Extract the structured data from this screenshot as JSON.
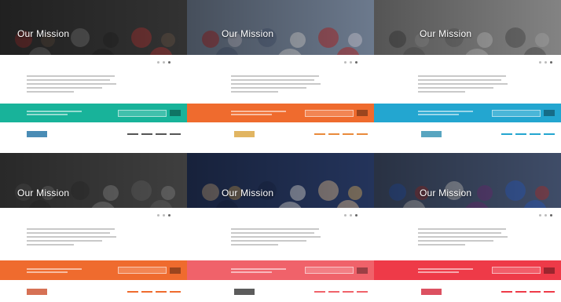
{
  "panels": [
    {
      "title": "Our Mission",
      "bar_color": "#18b39a",
      "nav_color": "#555555",
      "logo": "",
      "logo_color": "#1d6fa3",
      "hero_base": "#3b3b3b",
      "crowd": [
        "#b23b3b",
        "#6b5a4a",
        "#888888",
        "#2b2b2b"
      ]
    },
    {
      "title": "Our Mission",
      "bar_color": "#ef6b2e",
      "nav_color": "#e98a3b",
      "logo": "",
      "logo_color": "#d9a23b",
      "hero_base": "#7f8fa6",
      "crowd": [
        "#c93232",
        "#d8d8e6",
        "#5a6b8a",
        "#f0f0f0"
      ]
    },
    {
      "title": "Our Mission",
      "bar_color": "#23a6d0",
      "nav_color": "#23a6d0",
      "logo": "",
      "logo_color": "#2e8fb0",
      "hero_base": "#9a9a9a",
      "crowd": [
        "#5c5c5c",
        "#bcbcbc",
        "#777777",
        "#dcdcdc"
      ]
    },
    {
      "title": "Our Mission",
      "bar_color": "#ef6b2e",
      "nav_color": "#ef6b2e",
      "logo": "",
      "logo_color": "#cc4d2a",
      "hero_base": "#4a4a4a",
      "crowd": [
        "#6b6b6b",
        "#8a8a8a",
        "#3a3a3a",
        "#9a9a9a"
      ]
    },
    {
      "title": "Our Mission",
      "bar_color": "#f0626a",
      "nav_color": "#f0626a",
      "logo": "",
      "logo_color": "#333333",
      "hero_base": "#2a3d6b",
      "crowd": [
        "#e9c9a0",
        "#d8b06a",
        "#1f2f55",
        "#f2f2f2"
      ]
    },
    {
      "title": "Our Mission",
      "bar_color": "#ee3a48",
      "nav_color": "#ee3a48",
      "logo": "",
      "logo_color": "#d3263a",
      "hero_base": "#4a5a7a",
      "crowd": [
        "#3366cc",
        "#b03a3a",
        "#e0e0e0",
        "#7a3a8a"
      ]
    }
  ]
}
